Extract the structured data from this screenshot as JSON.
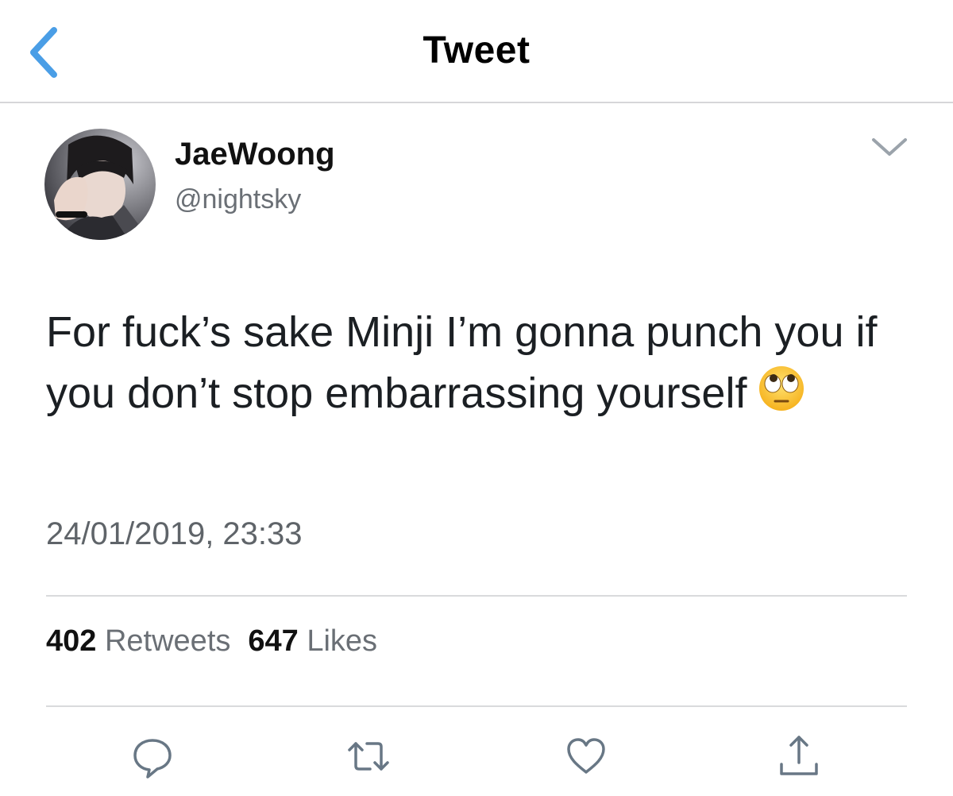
{
  "nav": {
    "title": "Tweet"
  },
  "author": {
    "display_name": "JaeWoong",
    "handle": "@nightsky"
  },
  "tweet": {
    "text": "For fuck’s sake Minji I’m gonna punch you if you don’t stop embarrassing yourself",
    "emoji": "face-with-rolling-eyes",
    "timestamp": "24/01/2019, 23:33"
  },
  "stats": {
    "retweets_count": "402",
    "retweets_label": "Retweets",
    "likes_count": "647",
    "likes_label": "Likes"
  },
  "actions": [
    "reply-icon",
    "retweet-icon",
    "like-icon",
    "share-icon"
  ],
  "colors": {
    "accent_blue": "#4a9ee6",
    "icon_gray": "#687785",
    "text_dark": "#1b1f23",
    "text_secondary": "#6a6f75",
    "divider": "#d9dadc"
  }
}
